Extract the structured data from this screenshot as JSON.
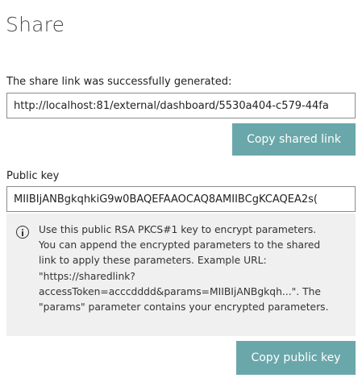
{
  "share": {
    "title": "Share",
    "success_message": "The share link was successfully generated:",
    "link_value": "http://localhost:81/external/dashboard/5530a404-c579-44fa",
    "copy_link_label": "Copy shared link",
    "public_key_label": "Public key",
    "public_key_value": "MIIBIjANBgkqhkiG9w0BAQEFAAOCAQ8AMIIBCgKCAQEA2s(",
    "info": {
      "icon": "info-icon",
      "lines": [
        "Use this public RSA PKCS#1 key to encrypt parameters.",
        "You can append the encrypted parameters to the shared",
        "link to apply these parameters. Example URL:",
        "\"https://sharedlink?",
        "accessToken=acccdddd&params=MIIBIjANBgkqh...\". The",
        "\"params\" parameter contains your encrypted parameters."
      ]
    },
    "copy_key_label": "Copy public key"
  },
  "colors": {
    "button_bg": "#6aa7aa",
    "button_text": "#ffffff",
    "info_bg": "#f0f0f0",
    "title": "#4a4a4a",
    "field_border": "#8c8c8c"
  }
}
